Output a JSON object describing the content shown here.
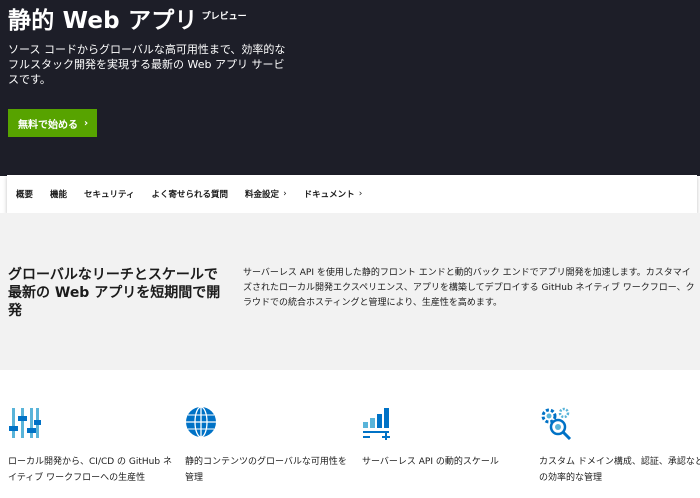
{
  "hero": {
    "title": "静的 Web アプリ",
    "badge": "プレビュー",
    "description": "ソース コードからグローバルな高可用性まで、効率的なフルスタック開発を実現する最新の Web アプリ サービスです。",
    "cta_label": "無料で始める",
    "cta_color": "#57a300",
    "background": "#1d1e28"
  },
  "subnav": {
    "items": [
      {
        "label": "概要",
        "has_chevron": false
      },
      {
        "label": "機能",
        "has_chevron": false
      },
      {
        "label": "セキュリティ",
        "has_chevron": false
      },
      {
        "label": "よく寄せられる質問",
        "has_chevron": false
      },
      {
        "label": "料金設定",
        "has_chevron": true
      },
      {
        "label": "ドキュメント",
        "has_chevron": true
      }
    ]
  },
  "band": {
    "heading": "グローバルなリーチとスケールで最新の Web アプリを短期間で開発",
    "body": "サーバーレス API を使用した静的フロント エンドと動的バック エンドでアプリ開発を加速します。カスタマイズされたローカル開発エクスペリエンス、アプリを構築してデプロイする GitHub ネイティブ ワークフロー、クラウドでの統合ホスティングと管理により、生産性を高めます。"
  },
  "features": [
    {
      "icon": "sliders-icon",
      "text": "ローカル開発から、CI/CD の GitHub ネイティブ ワークフローへの生産性"
    },
    {
      "icon": "globe-icon",
      "text": "静的コンテンツのグローバルな可用性を管理"
    },
    {
      "icon": "scale-chart-icon",
      "text": "サーバーレス API の動的スケール"
    },
    {
      "icon": "settings-search-icon",
      "text": "カスタム ドメイン構成、認証、承認などの効率的な管理"
    }
  ]
}
